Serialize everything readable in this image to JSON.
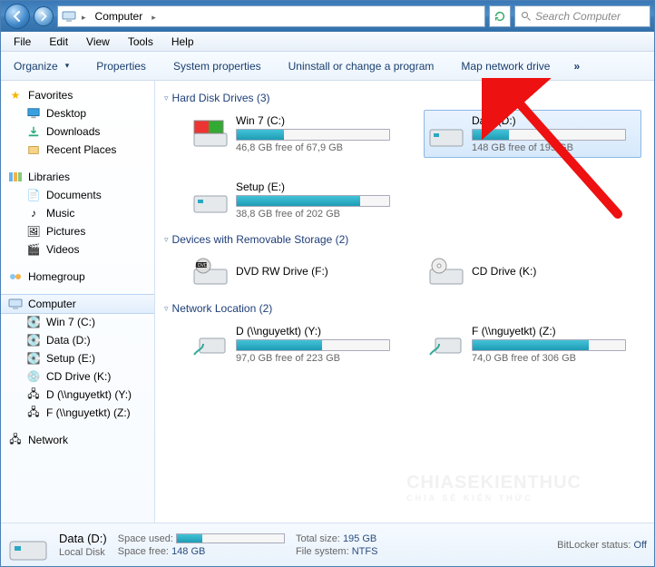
{
  "address": {
    "root_label": "Computer"
  },
  "search": {
    "placeholder": "Search Computer"
  },
  "menu": {
    "items": [
      "File",
      "Edit",
      "View",
      "Tools",
      "Help"
    ]
  },
  "toolbar": {
    "organize": "Organize",
    "properties": "Properties",
    "system_properties": "System properties",
    "uninstall": "Uninstall or change a program",
    "map_drive": "Map network drive",
    "more": "»"
  },
  "sidebar": {
    "favorites": {
      "label": "Favorites",
      "items": [
        "Desktop",
        "Downloads",
        "Recent Places"
      ]
    },
    "libraries": {
      "label": "Libraries",
      "items": [
        "Documents",
        "Music",
        "Pictures",
        "Videos"
      ]
    },
    "homegroup": {
      "label": "Homegroup"
    },
    "computer": {
      "label": "Computer",
      "items": [
        "Win 7 (C:)",
        "Data (D:)",
        "Setup (E:)",
        "CD Drive (K:)",
        "D (\\\\nguyetkt) (Y:)",
        "F (\\\\nguyetkt) (Z:)"
      ]
    },
    "network": {
      "label": "Network"
    }
  },
  "sections": {
    "hdd": {
      "title": "Hard Disk Drives (3)",
      "drives": [
        {
          "name": "Win 7 (C:)",
          "free": "46,8 GB free of 67,9 GB",
          "fill": 31
        },
        {
          "name": "Data (D:)",
          "free": "148 GB free of 195 GB",
          "fill": 24,
          "selected": true
        },
        {
          "name": "Setup (E:)",
          "free": "38,8 GB free of 202 GB",
          "fill": 81
        }
      ]
    },
    "removable": {
      "title": "Devices with Removable Storage (2)",
      "drives": [
        {
          "name": "DVD RW Drive (F:)"
        },
        {
          "name": "CD Drive (K:)"
        }
      ]
    },
    "network": {
      "title": "Network Location (2)",
      "drives": [
        {
          "name": "D (\\\\nguyetkt) (Y:)",
          "free": "97,0 GB free of 223 GB",
          "fill": 56
        },
        {
          "name": "F (\\\\nguyetkt) (Z:)",
          "free": "74,0 GB free of 306 GB",
          "fill": 76
        }
      ]
    }
  },
  "status": {
    "title": "Data (D:)",
    "subtitle": "Local Disk",
    "space_used_label": "Space used:",
    "space_used_fill": 24,
    "space_free_label": "Space free:",
    "space_free": "148 GB",
    "total_size_label": "Total size:",
    "total_size": "195 GB",
    "fs_label": "File system:",
    "fs": "NTFS",
    "bitlocker_label": "BitLocker status:",
    "bitlocker": "Off"
  },
  "watermark": {
    "line1": "CHIASEKIENTHUC",
    "line2": "CHIA SẺ KIẾN THỨC"
  }
}
